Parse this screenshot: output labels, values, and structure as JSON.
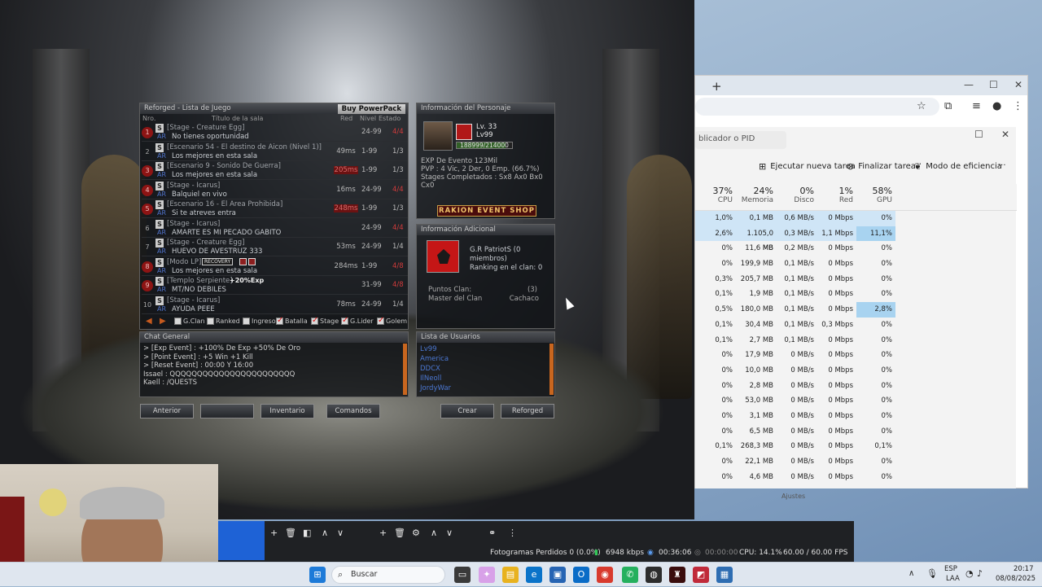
{
  "game": {
    "room_list": {
      "title": "Reforged - Lista de Juego",
      "buy_button": "Buy PowerPack",
      "headers": {
        "nro": "Nro.",
        "title": "Título de la sala",
        "red": "Red",
        "nivel": "Nivel",
        "estado": "Estado"
      },
      "rooms": [
        {
          "num": "1",
          "locked": true,
          "mode": "[Stage - Creature Egg]",
          "name": "No tienes oportunidad",
          "red": "",
          "red_bad": false,
          "level": "24-99",
          "status": "4/4",
          "full": true
        },
        {
          "num": "2",
          "locked": false,
          "mode": "[Escenario 54 - El destino de Aicon (Nivel 1)]",
          "name": "Los mejores en esta sala",
          "red": "49ms",
          "red_bad": false,
          "level": "1-99",
          "status": "1/3",
          "full": false
        },
        {
          "num": "3",
          "locked": true,
          "mode": "[Escenario 9 - Sonido De Guerra]",
          "name": "Los mejores en esta sala",
          "red": "205ms",
          "red_bad": true,
          "level": "1-99",
          "status": "1/3",
          "full": false
        },
        {
          "num": "4",
          "locked": true,
          "mode": "[Stage - Icarus]",
          "name": "Balquiel en vivo",
          "red": "16ms",
          "red_bad": false,
          "level": "24-99",
          "status": "4/4",
          "full": true
        },
        {
          "num": "5",
          "locked": true,
          "mode": "[Escenario 16 - El Area Prohibida]",
          "name": "Si te atreves entra",
          "red": "248ms",
          "red_bad": true,
          "level": "1-99",
          "status": "1/3",
          "full": false
        },
        {
          "num": "6",
          "locked": false,
          "mode": "[Stage - Icarus]",
          "name": "AMARTE ES MI PECADO GABITO",
          "red": "",
          "red_bad": false,
          "level": "24-99",
          "status": "4/4",
          "full": true
        },
        {
          "num": "7",
          "locked": false,
          "mode": "[Stage - Creature Egg]",
          "name": "HUEVO DE AVESTRUZ 333",
          "red": "53ms",
          "red_bad": false,
          "level": "24-99",
          "status": "1/4",
          "full": false
        },
        {
          "num": "8",
          "locked": true,
          "mode": "[Modo LP]",
          "name": "Los mejores en esta sala",
          "red": "284ms",
          "red_bad": false,
          "level": "1-99",
          "status": "4/8",
          "full": true,
          "badge": "RECOVERY"
        },
        {
          "num": "9",
          "locked": true,
          "mode": "[Templo Serpiente]",
          "name": "MT/NO DEBILES",
          "red": "",
          "red_bad": false,
          "level": "31-99",
          "status": "4/8",
          "full": true,
          "exp": "+20%Exp"
        },
        {
          "num": "10",
          "locked": false,
          "mode": "[Stage - Icarus]",
          "name": "AYUDA PEEE",
          "red": "78ms",
          "red_bad": false,
          "level": "24-99",
          "status": "1/4",
          "full": false
        }
      ],
      "ar_label": "AR",
      "filters": [
        {
          "label": "G.Clan",
          "checked": false
        },
        {
          "label": "Ranked",
          "checked": false
        },
        {
          "label": "Ingreso",
          "checked": false
        },
        {
          "label": "Batalla",
          "checked": true
        },
        {
          "label": "Stage",
          "checked": true
        },
        {
          "label": "G.Lider",
          "checked": true
        },
        {
          "label": "Golem",
          "checked": true
        }
      ]
    },
    "char_info": {
      "title": "Información del Personaje",
      "level": "Lv. 33",
      "lv_tag": "Lv99",
      "xp": "188999/214000",
      "xp_fraction": 0.883,
      "exp_event": "EXP De Evento 123Mil",
      "pvp": "PVP : 4 Vic, 2 Der, 0 Emp. (66.7%)",
      "stages": "Stages Completados : Sx8 Ax0 Bx0 Cx0",
      "shop_button": "RAKION EVENT SHOP"
    },
    "additional_info": {
      "title": "Información Adicional",
      "clan_name": "G.R PatriotS (0 miembros)",
      "ranking": "Ranking en el clan: 0",
      "points_label": "Puntos Clan:",
      "points_value": "(3)",
      "master_label": "Master del Clan",
      "master_value": "Cachaco"
    },
    "chat": {
      "title": "Chat General",
      "lines": [
        "> [Exp Event] : +100% De Exp +50% De Oro",
        "> [Point Event] : +5 Win +1 Kill",
        "> [Reset Event] : 00:00 Y 16:00",
        "Issael : QQQQQQQQQQQQQQQQQQQQQQQ",
        "Kaell : /QUESTS"
      ]
    },
    "users": {
      "title": "Lista de Usuarios",
      "names": [
        "Lv99",
        "America",
        "DDCX",
        "IlNeoll",
        "JordyWar"
      ]
    },
    "buttons": {
      "anterior": "Anterior",
      "blank": "",
      "inventario": "Inventario",
      "comandos": "Comandos",
      "crear": "Crear",
      "reforged": "Reforged"
    }
  },
  "task_manager": {
    "search_placeholder": "blicador o PID",
    "actions": {
      "new_task": "Ejecutar nueva tarea",
      "end_task": "Finalizar tarea",
      "efficiency": "Modo de eficiencia",
      "more": "···"
    },
    "columns": [
      {
        "pct": "37%",
        "label": "CPU"
      },
      {
        "pct": "24%",
        "label": "Memoria"
      },
      {
        "pct": "0%",
        "label": "Disco"
      },
      {
        "pct": "1%",
        "label": "Red"
      },
      {
        "pct": "58%",
        "label": "GPU"
      }
    ],
    "rows": [
      [
        "1,0%",
        "0,1 MB",
        "0,6 MB/s",
        "0 Mbps",
        "0%"
      ],
      [
        "2,6%",
        "1.105,0 MB",
        "0,3 MB/s",
        "1,1 Mbps",
        "11,1%"
      ],
      [
        "0%",
        "11,6 MB",
        "0,2 MB/s",
        "0 Mbps",
        "0%"
      ],
      [
        "0%",
        "199,9 MB",
        "0,1 MB/s",
        "0 Mbps",
        "0%"
      ],
      [
        "0,3%",
        "205,7 MB",
        "0,1 MB/s",
        "0 Mbps",
        "0%"
      ],
      [
        "0,1%",
        "1,9 MB",
        "0,1 MB/s",
        "0 Mbps",
        "0%"
      ],
      [
        "0,5%",
        "180,0 MB",
        "0,1 MB/s",
        "0 Mbps",
        "2,8%"
      ],
      [
        "0,1%",
        "30,4 MB",
        "0,1 MB/s",
        "0,3 Mbps",
        "0%"
      ],
      [
        "0,1%",
        "2,7 MB",
        "0,1 MB/s",
        "0 Mbps",
        "0%"
      ],
      [
        "0%",
        "17,9 MB",
        "0 MB/s",
        "0 Mbps",
        "0%"
      ],
      [
        "0%",
        "10,0 MB",
        "0 MB/s",
        "0 Mbps",
        "0%"
      ],
      [
        "0%",
        "2,8 MB",
        "0 MB/s",
        "0 Mbps",
        "0%"
      ],
      [
        "0%",
        "53,0 MB",
        "0 MB/s",
        "0 Mbps",
        "0%"
      ],
      [
        "0%",
        "3,1 MB",
        "0 MB/s",
        "0 Mbps",
        "0%"
      ],
      [
        "0%",
        "6,5 MB",
        "0 MB/s",
        "0 Mbps",
        "0%"
      ],
      [
        "0,1%",
        "268,3 MB",
        "0 MB/s",
        "0 Mbps",
        "0,1%"
      ],
      [
        "0%",
        "22,1 MB",
        "0 MB/s",
        "0 Mbps",
        "0%"
      ],
      [
        "0%",
        "4,6 MB",
        "0 MB/s",
        "0 Mbps",
        "0%"
      ]
    ],
    "partial_text": "Ajustes"
  },
  "obs": {
    "dropped": "Fotogramas Perdidos 0 (0.0%)",
    "bitrate": "6948 kbps",
    "rec_time": "00:36:06",
    "stream_time": "00:00:00",
    "cpu": "CPU: 14.1%",
    "fps": "60.00 / 60.00 FPS"
  },
  "taskbar": {
    "search": "Buscar",
    "lang": "ESP",
    "lang2": "LAA",
    "time": "20:17",
    "date": "08/08/2025"
  },
  "colors": {
    "accent": "#c65a1e",
    "tm_highlight": "#cfe5f6",
    "taskbar": "#dfe6ef"
  }
}
